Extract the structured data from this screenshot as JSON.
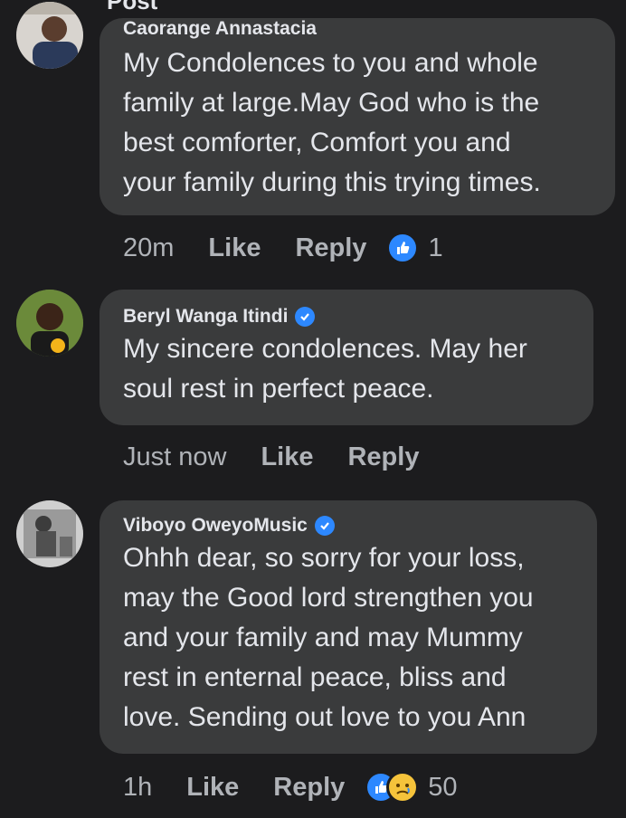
{
  "header": {
    "title": "Post"
  },
  "comments": [
    {
      "author": "Caorange Annastacia",
      "verified": false,
      "lines": [
        "My Condolences to you and whole",
        "family at large.May God who is the",
        "best comforter, Comfort you and",
        "your family during this trying times."
      ],
      "time": "20m",
      "like_label": "Like",
      "reply_label": "Reply",
      "reaction_count": "1"
    },
    {
      "author": "Beryl Wanga Itindi",
      "verified": true,
      "lines": [
        "My sincere condolences. May her",
        "soul rest in perfect peace."
      ],
      "time": "Just now",
      "like_label": "Like",
      "reply_label": "Reply"
    },
    {
      "author": "Viboyo OweyoMusic",
      "verified": true,
      "lines": [
        "Ohhh dear, so sorry for your loss,",
        "may the Good lord strengthen you",
        "and your family and may Mummy",
        "rest in enternal peace, bliss and",
        "love. Sending out love to you Ann"
      ],
      "time": "1h",
      "like_label": "Like",
      "reply_label": "Reply",
      "reaction_count": "50"
    }
  ],
  "colors": {
    "background": "#1c1c1e",
    "bubble": "#3a3b3c",
    "accent": "#2d88ff",
    "muted_text": "#b0b3b8"
  }
}
